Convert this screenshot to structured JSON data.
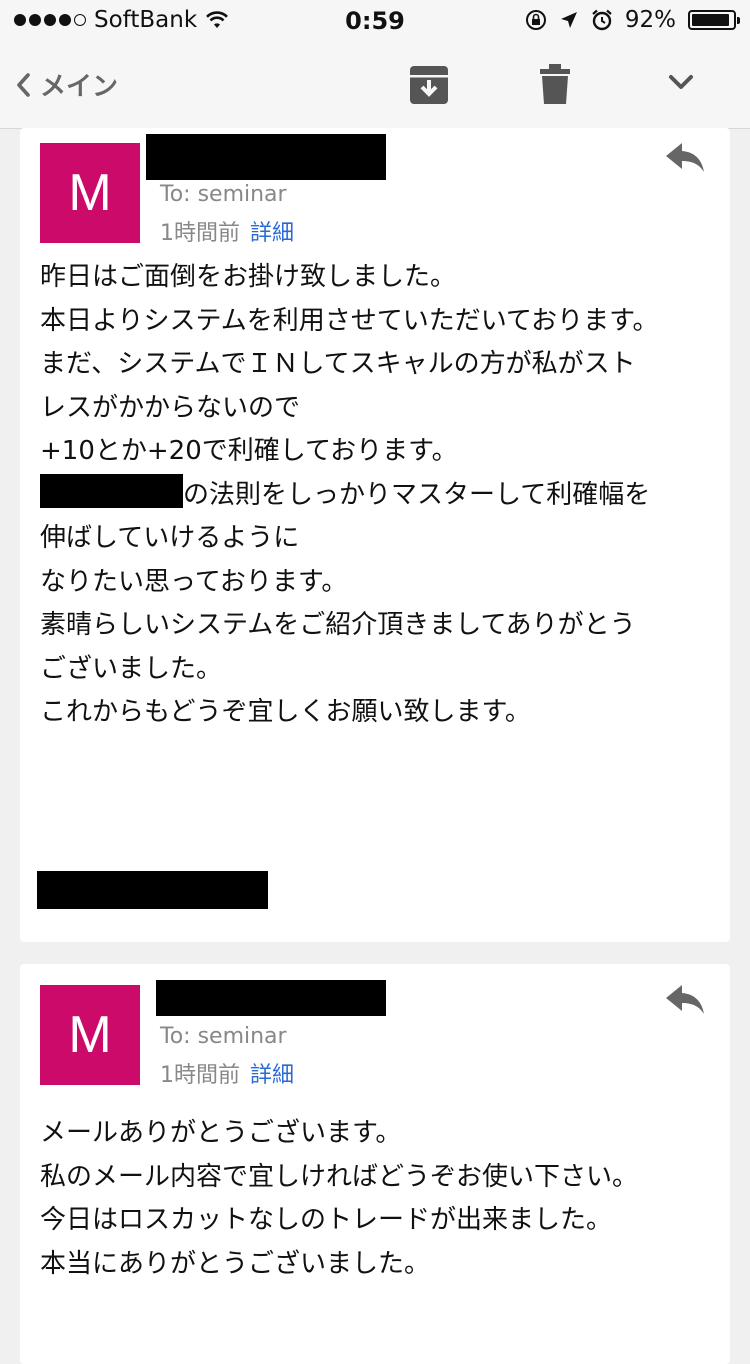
{
  "status": {
    "carrier": "SoftBank",
    "time": "0:59",
    "battery_pct": "92%",
    "battery_level": 0.92
  },
  "toolbar": {
    "back_label": "メイン",
    "icons": [
      "archive-icon",
      "trash-icon",
      "chevron-down-icon"
    ]
  },
  "emails": [
    {
      "avatar_letter": "M",
      "to": "To: seminar",
      "time": "1時間前",
      "detail_label": "詳細",
      "body": [
        "昨日はご面倒をお掛け致しました。",
        "本日よりシステムを利用させていただいております。",
        "まだ、システムでＩＮしてスキャルの方が私がスト",
        "レスがかからないので",
        "+10とか+20で利確しております。",
        "の法則をしっかりマスターして利確幅を",
        "伸ばしていけるように",
        "なりたい思っております。",
        "素晴らしいシステムをご紹介頂きましてありがとう",
        "ございました。",
        "これからもどうぞ宜しくお願い致します。"
      ]
    },
    {
      "avatar_letter": "M",
      "to": "To: seminar",
      "time": "1時間前",
      "detail_label": "詳細",
      "body": [
        "メールありがとうございます。",
        "私のメール内容で宜しければどうぞお使い下さい。",
        "今日はロスカットなしのトレードが出来ました。",
        "本当にありがとうございました。"
      ]
    }
  ]
}
